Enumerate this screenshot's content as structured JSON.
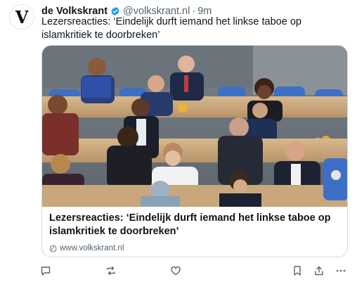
{
  "author": {
    "avatar_letter": "V",
    "name": "de Volkskrant",
    "handle": "@volkskrant.nl",
    "separator": "·",
    "time": "9m"
  },
  "post": {
    "text": "Lezersreacties: ‘Eindelijk durft iemand het linkse taboe op islamkritiek te doorbreken’"
  },
  "link_card": {
    "title": "Lezersreacties: ‘Eindelijk durft iemand het linkse taboe op islamkritiek te doorbreken’",
    "domain": "www.volkskrant.nl",
    "image_alt": "parliament-photo"
  },
  "actions": [
    "reply-icon",
    "repost-icon",
    "like-icon",
    "bookmark-icon",
    "share-icon",
    "more-icon"
  ],
  "colors": {
    "verified": "#1d9bf0",
    "muted": "#536471",
    "seat_blue": "#3d6fc4",
    "desk_wood": "#c9a77c"
  }
}
